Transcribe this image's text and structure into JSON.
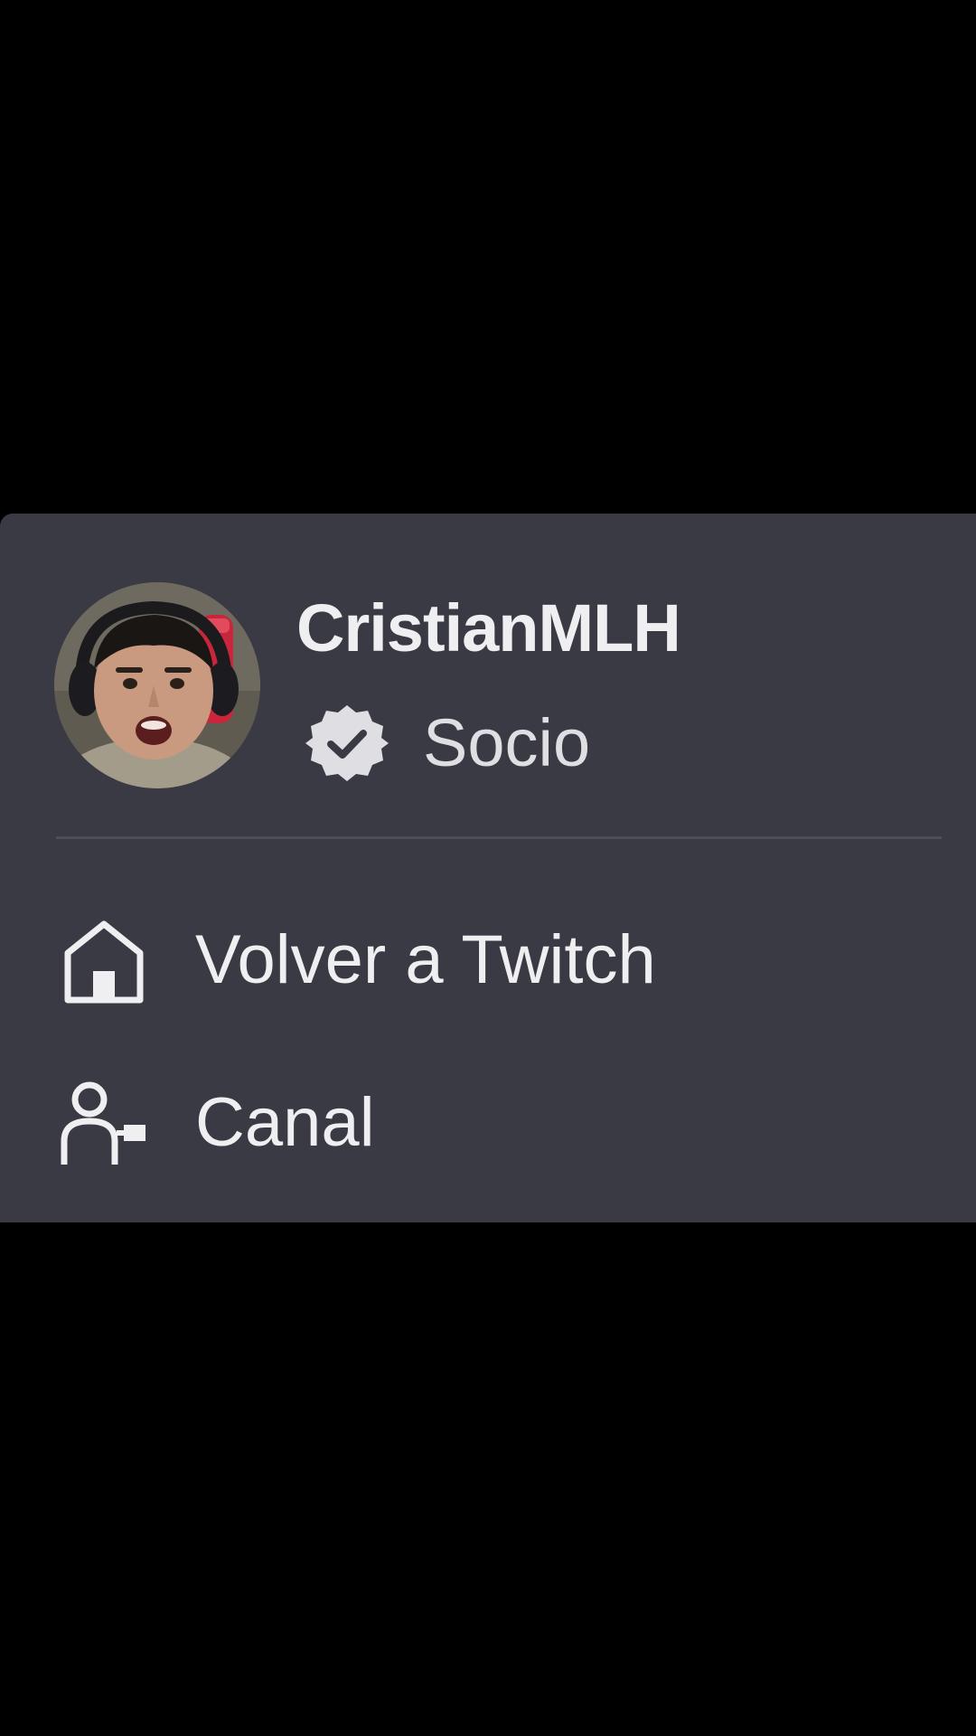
{
  "user": {
    "username": "CristianMLH",
    "badge_label": "Socio",
    "badge_icon": "verified-check-icon",
    "avatar": "avatar-photo"
  },
  "menu": {
    "items": [
      {
        "label": "Volver a Twitch",
        "icon": "home-icon"
      },
      {
        "label": "Canal",
        "icon": "channel-user-icon"
      }
    ]
  },
  "colors": {
    "page_background": "#000000",
    "panel_background": "#3a3a44",
    "text_primary": "#efeff1",
    "divider": "#4e4e58"
  }
}
